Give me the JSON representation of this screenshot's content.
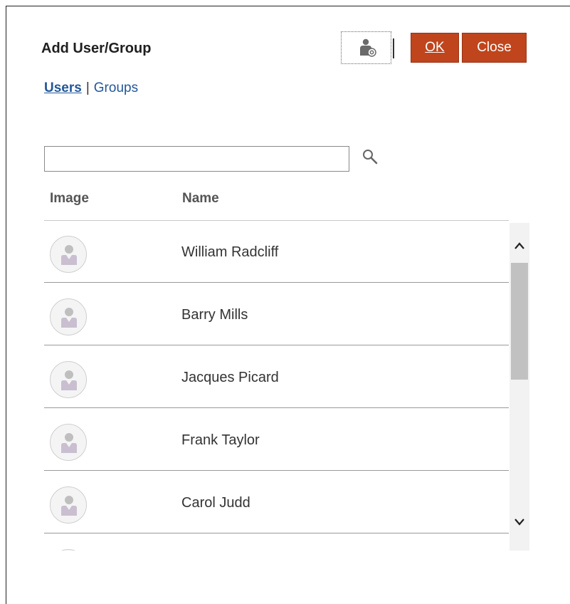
{
  "dialog": {
    "title": "Add User/Group",
    "ok_label": "OK",
    "close_label": "Close",
    "accent_color": "#c0451c",
    "toolbar_icon": "user-settings-icon"
  },
  "toggle": {
    "users_label": "Users",
    "separator": "|",
    "groups_label": "Groups",
    "selected": "Users"
  },
  "search": {
    "value": "",
    "placeholder": "",
    "icon": "search-icon"
  },
  "table": {
    "columns": [
      "Image",
      "Name"
    ],
    "rows": [
      {
        "name": "William Radcliff",
        "avatar": "user-avatar-icon"
      },
      {
        "name": "Barry Mills",
        "avatar": "user-avatar-icon"
      },
      {
        "name": "Jacques Picard",
        "avatar": "user-avatar-icon"
      },
      {
        "name": "Frank Taylor",
        "avatar": "user-avatar-icon"
      },
      {
        "name": "Carol Judd",
        "avatar": "user-avatar-icon"
      },
      {
        "name": "",
        "avatar": "user-avatar-icon"
      }
    ]
  }
}
